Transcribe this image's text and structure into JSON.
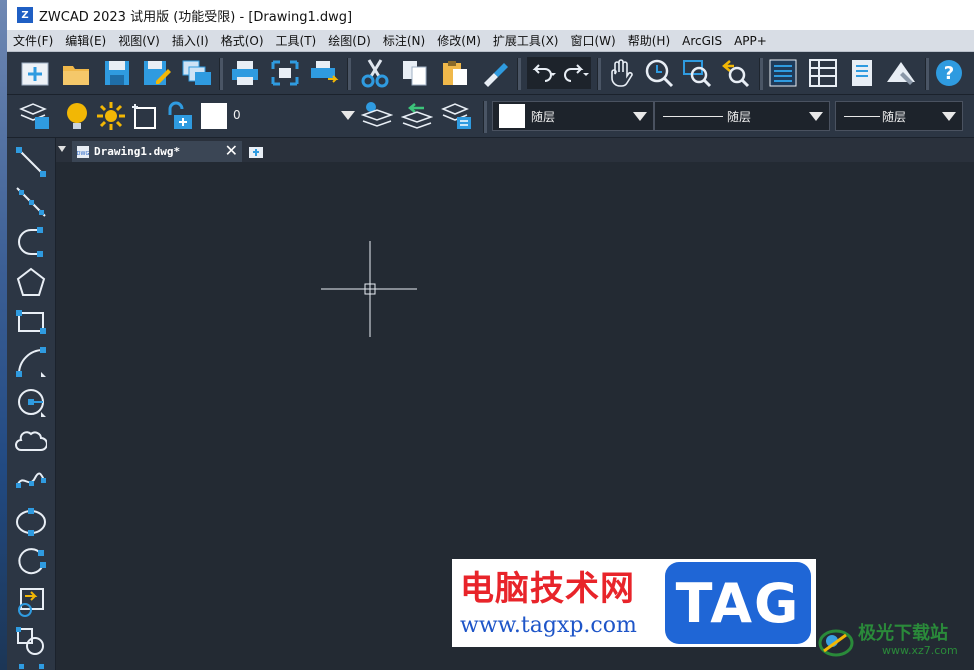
{
  "window": {
    "title": "ZWCAD 2023 试用版 (功能受限) - [Drawing1.dwg]",
    "logo_text": "Z"
  },
  "menu": [
    "文件(F)",
    "编辑(E)",
    "视图(V)",
    "插入(I)",
    "格式(O)",
    "工具(T)",
    "绘图(D)",
    "标注(N)",
    "修改(M)",
    "扩展工具(X)",
    "窗口(W)",
    "帮助(H)",
    "ArcGIS",
    "APP+"
  ],
  "layer_toolbar": {
    "current_layer": "0",
    "color": "随层",
    "linetype": "随层",
    "lineweight": "随层"
  },
  "document_tab": {
    "label": "Drawing1.dwg*",
    "file_badge": "DWG"
  },
  "watermark": {
    "site_name": "电脑技术网",
    "site_url": "www.tagxp.com",
    "tag": "TAG",
    "site2_name": "极光下载站",
    "site2_url": "www.xz7.com"
  },
  "colors": {
    "toolbar_bg": "#2c3644",
    "canvas_bg": "#232a33",
    "icon_blue": "#2f9be0",
    "icon_white": "#ffffff",
    "accent_yellow": "#f2b705"
  },
  "icons": {
    "toolbar1": [
      "new-icon",
      "open-icon",
      "save-icon",
      "save-as-icon",
      "sheet-set-icon",
      "print-icon",
      "print-preview-icon",
      "publish-icon",
      "cut-icon",
      "copy-icon",
      "paste-icon",
      "match-properties-icon",
      "undo-icon",
      "redo-icon",
      "pan-icon",
      "zoom-realtime-icon",
      "zoom-window-icon",
      "zoom-previous-icon",
      "properties-icon",
      "design-center-icon",
      "tool-palettes-icon",
      "markup-icon",
      "help-icon"
    ],
    "left_toolbar": [
      "line-icon",
      "construction-line-icon",
      "polyline-icon",
      "polygon-icon",
      "rectangle-icon",
      "arc-icon",
      "circle-icon",
      "revision-cloud-icon",
      "spline-icon",
      "ellipse-icon",
      "ellipse-arc-icon",
      "insert-block-icon",
      "make-block-icon"
    ]
  }
}
